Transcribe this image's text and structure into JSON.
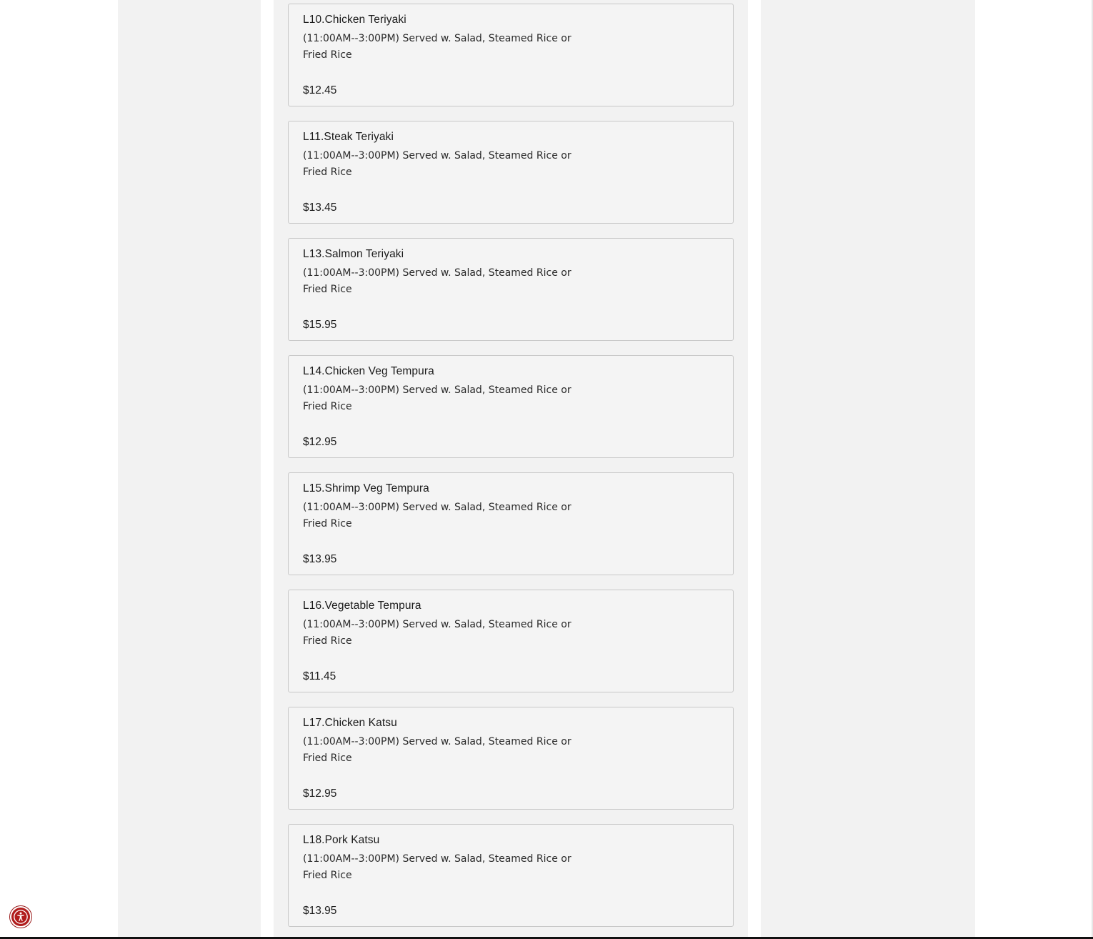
{
  "menu": {
    "items": [
      {
        "name": "L10.Chicken Teriyaki",
        "description": "(11:00AM--3:00PM) Served w. Salad, Steamed Rice or Fried Rice",
        "price": "$12.45"
      },
      {
        "name": "L11.Steak Teriyaki",
        "description": "(11:00AM--3:00PM) Served w. Salad, Steamed Rice or Fried Rice",
        "price": "$13.45"
      },
      {
        "name": "L13.Salmon Teriyaki",
        "description": "(11:00AM--3:00PM) Served w. Salad, Steamed Rice or Fried Rice",
        "price": "$15.95"
      },
      {
        "name": "L14.Chicken Veg Tempura",
        "description": "(11:00AM--3:00PM) Served w. Salad, Steamed Rice or Fried Rice",
        "price": "$12.95"
      },
      {
        "name": "L15.Shrimp Veg Tempura",
        "description": "(11:00AM--3:00PM) Served w. Salad, Steamed Rice or Fried Rice",
        "price": "$13.95"
      },
      {
        "name": "L16.Vegetable Tempura",
        "description": "(11:00AM--3:00PM) Served w. Salad, Steamed Rice or Fried Rice",
        "price": "$11.45"
      },
      {
        "name": "L17.Chicken Katsu",
        "description": "(11:00AM--3:00PM) Served w. Salad, Steamed Rice or Fried Rice",
        "price": "$12.95"
      },
      {
        "name": "L18.Pork Katsu",
        "description": "(11:00AM--3:00PM) Served w. Salad, Steamed Rice or Fried Rice",
        "price": "$13.95"
      }
    ]
  },
  "accessibility": {
    "icon": "accessibility-icon",
    "color": "#b11d1d"
  }
}
